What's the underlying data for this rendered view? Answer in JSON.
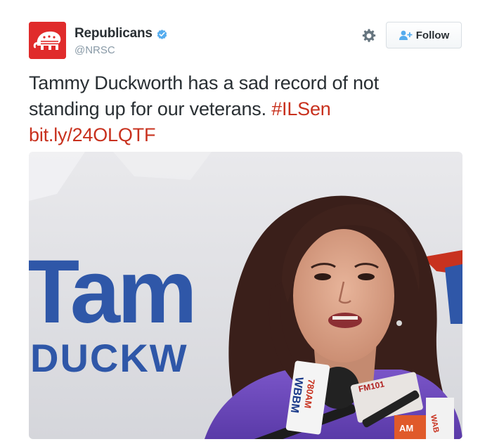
{
  "account": {
    "display_name": "Republicans",
    "handle": "@NRSC",
    "verified": true,
    "avatar_icon": "elephant-logo-icon",
    "avatar_color": "#e02b2b"
  },
  "actions": {
    "settings_icon": "gear-icon",
    "follow_label": "Follow",
    "follow_icon": "add-user-icon"
  },
  "tweet": {
    "text_line1": "Tammy Duckworth has a sad record of not",
    "text_line2_prefix": "standing up for our veterans. ",
    "hashtag": "#ILSen",
    "link": "bit.ly/24OLQTF",
    "link_color": "#c8311e"
  },
  "photo": {
    "banner_word_large": "Tam",
    "banner_word_small": "DUCKW",
    "mic_label_1": "WBBM 780AM",
    "mic_label_2": "WBBM",
    "mic_label_3": "780AM",
    "mic_label_4": "FM101",
    "mic_label_5": "AM",
    "mic_label_6": "WAB"
  }
}
